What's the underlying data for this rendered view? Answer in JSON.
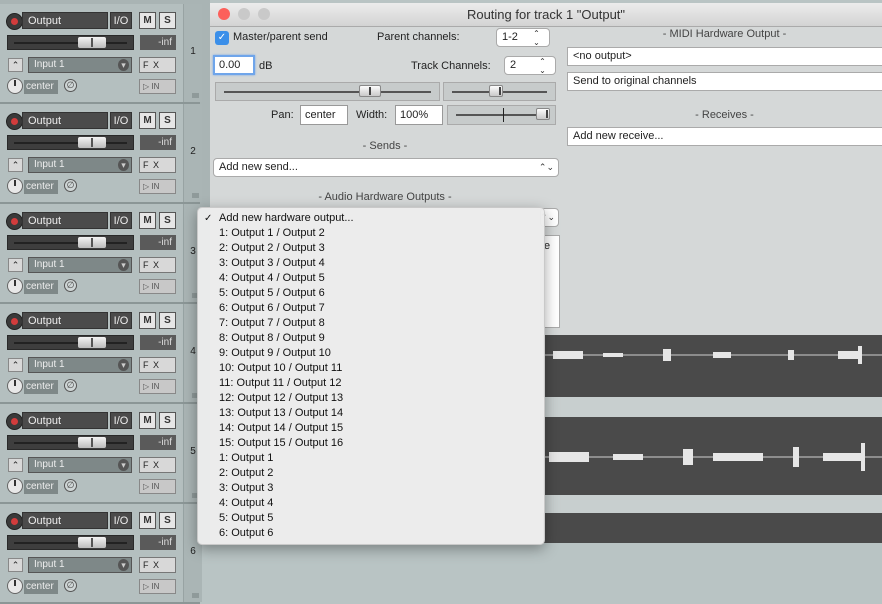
{
  "tracks": [
    {
      "name": "Output",
      "io": "I/O",
      "mute": "M",
      "solo": "S",
      "vol": "-inf",
      "fx": "F X",
      "input": "Input 1",
      "pan": "center",
      "phase": "∅",
      "in_btn": "IN",
      "number": "1"
    },
    {
      "name": "Output",
      "io": "I/O",
      "mute": "M",
      "solo": "S",
      "vol": "-inf",
      "fx": "F X",
      "input": "Input 1",
      "pan": "center",
      "phase": "∅",
      "in_btn": "IN",
      "number": "2"
    },
    {
      "name": "Output",
      "io": "I/O",
      "mute": "M",
      "solo": "S",
      "vol": "-inf",
      "fx": "F X",
      "input": "Input 1",
      "pan": "center",
      "phase": "∅",
      "in_btn": "IN",
      "number": "3"
    },
    {
      "name": "Output",
      "io": "I/O",
      "mute": "M",
      "solo": "S",
      "vol": "-inf",
      "fx": "F X",
      "input": "Input 1",
      "pan": "center",
      "phase": "∅",
      "in_btn": "IN",
      "number": "4"
    },
    {
      "name": "Output",
      "io": "I/O",
      "mute": "M",
      "solo": "S",
      "vol": "-inf",
      "fx": "F X",
      "input": "Input 1",
      "pan": "center",
      "phase": "∅",
      "in_btn": "IN",
      "number": "5"
    },
    {
      "name": "Output",
      "io": "I/O",
      "mute": "M",
      "solo": "S",
      "vol": "-inf",
      "fx": "F X",
      "input": "Input 1",
      "pan": "center",
      "phase": "∅",
      "in_btn": "IN",
      "number": "6"
    }
  ],
  "window": {
    "title": "Routing for track 1 \"Output\"",
    "master_send_label": "Master/parent send",
    "parent_channels_label": "Parent channels:",
    "parent_channels_value": "1-2",
    "volume_value": "0.00",
    "volume_unit": "dB",
    "track_channels_label": "Track Channels:",
    "track_channels_value": "2",
    "pan_label": "Pan:",
    "pan_value": "center",
    "width_label": "Width:",
    "width_value": "100%",
    "sends_header": "-  Sends  -",
    "add_send": "Add new send...",
    "hw_outputs_header": "-  Audio Hardware Outputs  -",
    "midi_hw_header": "-  MIDI Hardware Output  -",
    "midi_output_value": "<no output>",
    "midi_send_original": "Send to original channels",
    "receives_header": "-  Receives  -",
    "add_receive": "Add new receive..."
  },
  "menu": {
    "checked_item": "Add new hardware output...",
    "items": [
      "1: Output 1 / Output 2",
      "2: Output 2 / Output 3",
      "3: Output 3 / Output 4",
      "4: Output 4 / Output 5",
      "5: Output 5 / Output 6",
      "6: Output 6 / Output 7",
      "7: Output 7 / Output 8",
      "8: Output 8 / Output 9",
      "9: Output 9 / Output 10",
      "10: Output 10 / Output 11",
      "11: Output 11 / Output 12",
      "12: Output 12 / Output 13",
      "13: Output 13 / Output 14",
      "14: Output 14 / Output 15",
      "15: Output 15 / Output 16",
      "1: Output 1",
      "2: Output 2",
      "3: Output 3",
      "4: Output 4",
      "5: Output 5",
      "6: Output 6"
    ],
    "checkmark": "✓"
  }
}
